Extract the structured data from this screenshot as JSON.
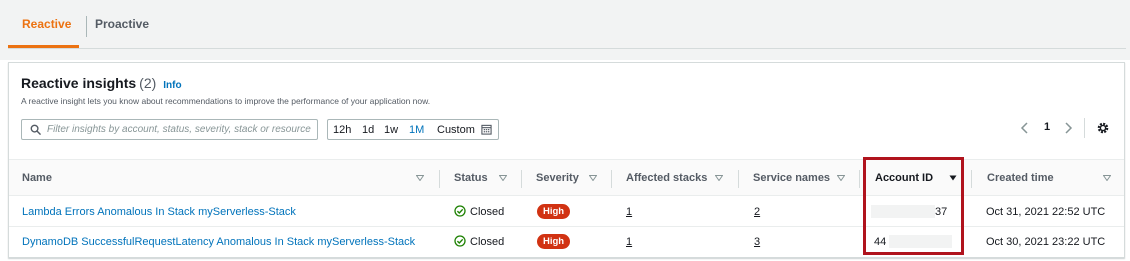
{
  "tabs": [
    {
      "label": "Reactive",
      "active": true
    },
    {
      "label": "Proactive",
      "active": false
    }
  ],
  "panel": {
    "title": "Reactive insights",
    "count": "(2)",
    "info": "Info",
    "description": "A reactive insight lets you know about recommendations to improve the performance of your application now."
  },
  "search": {
    "placeholder": "Filter insights by account, status, severity, stack or resource"
  },
  "time_range": {
    "options": [
      "12h",
      "1d",
      "1w",
      "1M",
      "Custom"
    ],
    "selected": "1M"
  },
  "pagination": {
    "current_page": "1"
  },
  "table": {
    "columns": [
      "Name",
      "Status",
      "Severity",
      "Affected stacks",
      "Service names",
      "Account ID",
      "Created time"
    ],
    "sorted_column": "Account ID",
    "rows": [
      {
        "name": "Lambda Errors Anomalous In Stack myServerless-Stack",
        "status": "Closed",
        "severity": "High",
        "affected_stacks": "1",
        "service_names": "2",
        "account_id": "37",
        "created_time": "Oct 31, 2021 22:52 UTC"
      },
      {
        "name": "DynamoDB SuccessfulRequestLatency Anomalous In Stack myServerless-Stack",
        "status": "Closed",
        "severity": "High",
        "affected_stacks": "1",
        "service_names": "3",
        "account_id": "44",
        "created_time": "Oct 30, 2021 23:22 UTC"
      }
    ]
  },
  "colors": {
    "accent": "#ec7211",
    "link": "#0073bb",
    "severity_high": "#d13212",
    "status_closed": "#1d8102",
    "highlight_box": "#b0131d"
  },
  "icons": {
    "search": "search-icon",
    "calendar": "calendar-icon",
    "prev": "chevron-left-icon",
    "next": "chevron-right-icon",
    "settings": "gear-icon",
    "sort": "caret-down-icon",
    "status": "check-circle-icon"
  }
}
